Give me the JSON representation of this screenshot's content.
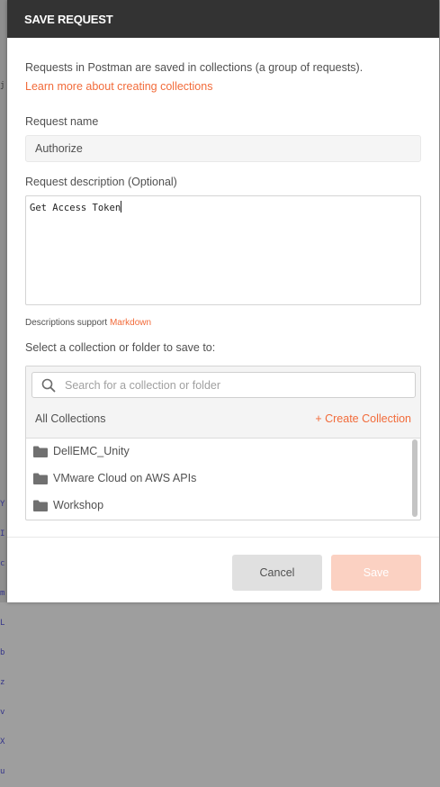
{
  "background": {
    "code_top": "j",
    "code_bottom": [
      "Y",
      "I",
      "c",
      "m",
      "L",
      "b",
      "z",
      "v",
      "X",
      "u"
    ]
  },
  "modal": {
    "title": "SAVE REQUEST",
    "intro_text": "Requests in Postman are saved in collections (a group of requests).",
    "learn_more_link": "Learn more about creating collections",
    "request_name_label": "Request name",
    "request_name_value": "Authorize",
    "request_description_label": "Request description (Optional)",
    "request_description_value": "Get Access Token",
    "descriptions_support_text": "Descriptions support",
    "markdown_link": "Markdown",
    "select_collection_label": "Select a collection or folder to save to:",
    "search": {
      "placeholder": "Search for a collection or folder",
      "icon": "search-icon"
    },
    "all_collections_label": "All Collections",
    "create_collection_link": "+ Create Collection",
    "collections": [
      {
        "name": "DellEMC_Unity",
        "icon": "folder-icon"
      },
      {
        "name": "VMware Cloud on AWS APIs",
        "icon": "folder-icon"
      },
      {
        "name": "Workshop",
        "icon": "folder-icon"
      }
    ],
    "buttons": {
      "cancel_label": "Cancel",
      "save_label": "Save"
    }
  },
  "colors": {
    "header_bg": "#333333",
    "accent": "#f26b3a",
    "save_disabled_bg": "#fbd1c2",
    "cancel_bg": "#e0e0e0"
  }
}
